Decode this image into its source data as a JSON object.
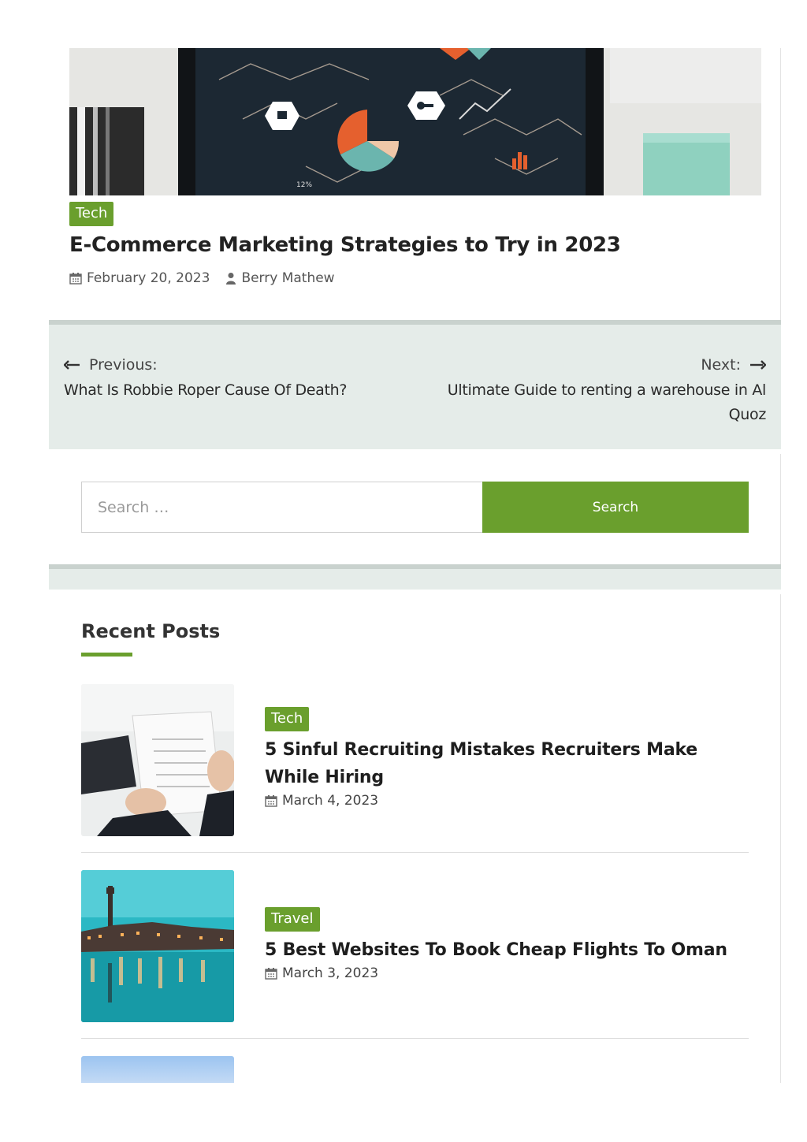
{
  "related_post": {
    "category": "Tech",
    "title": "E-Commerce Marketing Strategies to Try in 2023",
    "date": "February 20, 2023",
    "author": "Berry Mathew"
  },
  "post_nav": {
    "prev_label": "Previous:",
    "prev_title": "What Is Robbie Roper Cause Of Death?",
    "next_label": "Next:",
    "next_title": "Ultimate Guide to renting a warehouse in Al Quoz"
  },
  "search": {
    "placeholder": "Search …",
    "button_label": "Search"
  },
  "recent_posts": {
    "heading": "Recent Posts",
    "items": [
      {
        "category": "Tech",
        "title": "5 Sinful Recruiting Mistakes Recruiters Make While Hiring",
        "date": "March 4, 2023"
      },
      {
        "category": "Travel",
        "title": "5 Best Websites To Book Cheap Flights To Oman",
        "date": "March 3, 2023"
      }
    ]
  },
  "colors": {
    "accent": "#6a9f2d",
    "nav_background": "#e5ece9",
    "nav_border": "#c9d2ce"
  },
  "icons": [
    "calendar-icon",
    "user-icon",
    "arrow-left-icon",
    "arrow-right-icon"
  ]
}
